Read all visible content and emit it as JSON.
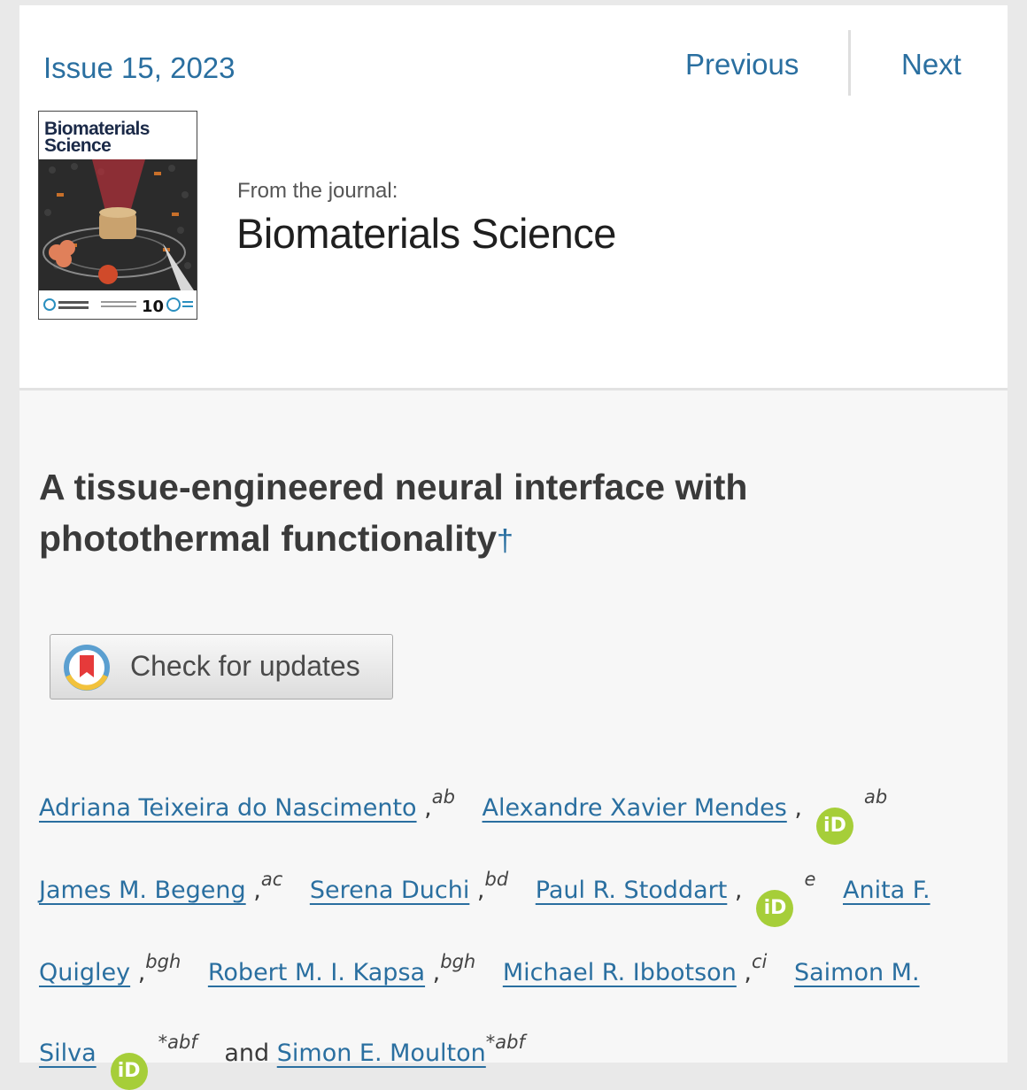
{
  "header": {
    "issue": "Issue 15, 2023",
    "nav": {
      "previous": "Previous",
      "next": "Next"
    },
    "cover": {
      "title_line1": "Biomaterials",
      "title_line2": "Science"
    },
    "from_label": "From the journal:",
    "journal_name": "Biomaterials Science"
  },
  "article": {
    "title": "A tissue-engineered neural interface with photothermal functionality",
    "title_mark": "†",
    "check_updates_label": "Check for updates",
    "orcid_label": "iD",
    "connector": "and",
    "authors": [
      {
        "name": "Adriana Teixeira do Nascimento",
        "aff": "ab",
        "orcid": false,
        "corresponding": false
      },
      {
        "name": "Alexandre Xavier Mendes",
        "aff": "ab",
        "orcid": true,
        "corresponding": false
      },
      {
        "name": "James M. Begeng",
        "aff": "ac",
        "orcid": false,
        "corresponding": false
      },
      {
        "name": "Serena Duchi",
        "aff": "bd",
        "orcid": false,
        "corresponding": false
      },
      {
        "name": "Paul R. Stoddart",
        "aff": "e",
        "orcid": true,
        "corresponding": false
      },
      {
        "name": "Anita F. Quigley",
        "aff": "bgh",
        "orcid": false,
        "corresponding": false
      },
      {
        "name": "Robert M. I. Kapsa",
        "aff": "bgh",
        "orcid": false,
        "corresponding": false
      },
      {
        "name": "Michael R. Ibbotson",
        "aff": "ci",
        "orcid": false,
        "corresponding": false
      },
      {
        "name": "Saimon M. Silva",
        "aff": "abf",
        "orcid": true,
        "corresponding": true
      },
      {
        "name": "Simon E. Moulton",
        "aff": "abf",
        "orcid": false,
        "corresponding": true
      }
    ]
  },
  "colors": {
    "link": "#2a6fa0",
    "orcid": "#a6ce39",
    "title": "#3a3a3a"
  }
}
